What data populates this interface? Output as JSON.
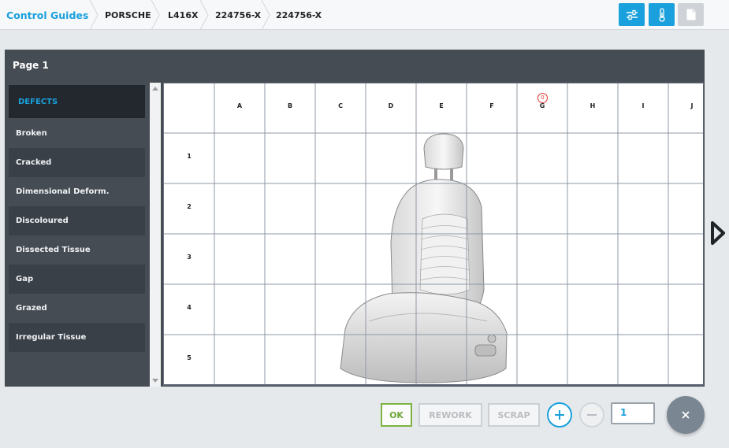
{
  "breadcrumb": [
    "Control Guides",
    "PORSCHE",
    "L416X",
    "224756-X",
    "224756-X"
  ],
  "toolbar": {
    "buttons": [
      {
        "name": "sliders-icon",
        "color": "#1aa0dc"
      },
      {
        "name": "thermometer-icon",
        "color": "#1aa0dc"
      },
      {
        "name": "document-icon",
        "color": "#cfd3d7"
      }
    ]
  },
  "panel": {
    "title": "Page 1"
  },
  "defects": {
    "header": "DEFECTS",
    "items": [
      "Broken",
      "Cracked",
      "Dimensional Deform.",
      "Discoloured",
      "Dissected Tissue",
      "Gap",
      "Grazed",
      "Irregular Tissue"
    ]
  },
  "grid": {
    "columns": [
      "A",
      "B",
      "C",
      "D",
      "E",
      "F",
      "G",
      "H",
      "I",
      "J"
    ],
    "rows": [
      "1",
      "2",
      "3",
      "4",
      "5"
    ],
    "marker": {
      "label": "0",
      "column": "G",
      "row": "header"
    }
  },
  "actions": {
    "ok": "OK",
    "rework": "REWORK",
    "scrap": "SCRAP",
    "quantity": "1"
  },
  "colors": {
    "accent": "#1aa0dc",
    "ok": "#7cb342",
    "panel": "#454c54",
    "marker": "#e0332b"
  }
}
